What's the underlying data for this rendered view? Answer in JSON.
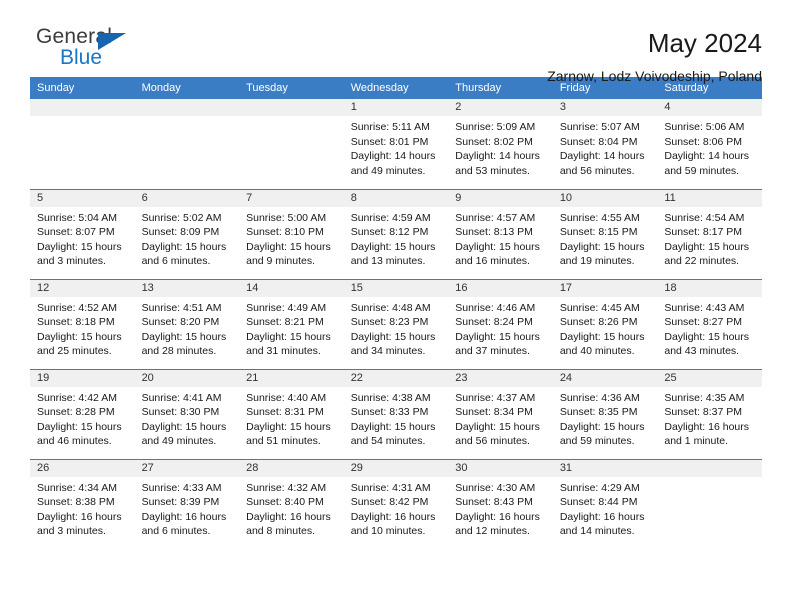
{
  "brand": {
    "word_one": "General",
    "word_two": "Blue",
    "triangle_color": "#1565b0",
    "blue_text_color": "#1a76c8"
  },
  "header": {
    "title": "May 2024",
    "subtitle": "Zarnow, Lodz Voivodeship, Poland"
  },
  "theme": {
    "header_bg": "#3a7dc4",
    "daynum_bg": "#f0f0f0",
    "row_divider": "#3a7dc4"
  },
  "weekdays": [
    "Sunday",
    "Monday",
    "Tuesday",
    "Wednesday",
    "Thursday",
    "Friday",
    "Saturday"
  ],
  "weeks": [
    [
      {
        "blank": true
      },
      {
        "blank": true
      },
      {
        "blank": true
      },
      {
        "day": "1",
        "sunrise": "Sunrise: 5:11 AM",
        "sunset": "Sunset: 8:01 PM",
        "daylight1": "Daylight: 14 hours",
        "daylight2": "and 49 minutes."
      },
      {
        "day": "2",
        "sunrise": "Sunrise: 5:09 AM",
        "sunset": "Sunset: 8:02 PM",
        "daylight1": "Daylight: 14 hours",
        "daylight2": "and 53 minutes."
      },
      {
        "day": "3",
        "sunrise": "Sunrise: 5:07 AM",
        "sunset": "Sunset: 8:04 PM",
        "daylight1": "Daylight: 14 hours",
        "daylight2": "and 56 minutes."
      },
      {
        "day": "4",
        "sunrise": "Sunrise: 5:06 AM",
        "sunset": "Sunset: 8:06 PM",
        "daylight1": "Daylight: 14 hours",
        "daylight2": "and 59 minutes."
      }
    ],
    [
      {
        "day": "5",
        "sunrise": "Sunrise: 5:04 AM",
        "sunset": "Sunset: 8:07 PM",
        "daylight1": "Daylight: 15 hours",
        "daylight2": "and 3 minutes."
      },
      {
        "day": "6",
        "sunrise": "Sunrise: 5:02 AM",
        "sunset": "Sunset: 8:09 PM",
        "daylight1": "Daylight: 15 hours",
        "daylight2": "and 6 minutes."
      },
      {
        "day": "7",
        "sunrise": "Sunrise: 5:00 AM",
        "sunset": "Sunset: 8:10 PM",
        "daylight1": "Daylight: 15 hours",
        "daylight2": "and 9 minutes."
      },
      {
        "day": "8",
        "sunrise": "Sunrise: 4:59 AM",
        "sunset": "Sunset: 8:12 PM",
        "daylight1": "Daylight: 15 hours",
        "daylight2": "and 13 minutes."
      },
      {
        "day": "9",
        "sunrise": "Sunrise: 4:57 AM",
        "sunset": "Sunset: 8:13 PM",
        "daylight1": "Daylight: 15 hours",
        "daylight2": "and 16 minutes."
      },
      {
        "day": "10",
        "sunrise": "Sunrise: 4:55 AM",
        "sunset": "Sunset: 8:15 PM",
        "daylight1": "Daylight: 15 hours",
        "daylight2": "and 19 minutes."
      },
      {
        "day": "11",
        "sunrise": "Sunrise: 4:54 AM",
        "sunset": "Sunset: 8:17 PM",
        "daylight1": "Daylight: 15 hours",
        "daylight2": "and 22 minutes."
      }
    ],
    [
      {
        "day": "12",
        "sunrise": "Sunrise: 4:52 AM",
        "sunset": "Sunset: 8:18 PM",
        "daylight1": "Daylight: 15 hours",
        "daylight2": "and 25 minutes."
      },
      {
        "day": "13",
        "sunrise": "Sunrise: 4:51 AM",
        "sunset": "Sunset: 8:20 PM",
        "daylight1": "Daylight: 15 hours",
        "daylight2": "and 28 minutes."
      },
      {
        "day": "14",
        "sunrise": "Sunrise: 4:49 AM",
        "sunset": "Sunset: 8:21 PM",
        "daylight1": "Daylight: 15 hours",
        "daylight2": "and 31 minutes."
      },
      {
        "day": "15",
        "sunrise": "Sunrise: 4:48 AM",
        "sunset": "Sunset: 8:23 PM",
        "daylight1": "Daylight: 15 hours",
        "daylight2": "and 34 minutes."
      },
      {
        "day": "16",
        "sunrise": "Sunrise: 4:46 AM",
        "sunset": "Sunset: 8:24 PM",
        "daylight1": "Daylight: 15 hours",
        "daylight2": "and 37 minutes."
      },
      {
        "day": "17",
        "sunrise": "Sunrise: 4:45 AM",
        "sunset": "Sunset: 8:26 PM",
        "daylight1": "Daylight: 15 hours",
        "daylight2": "and 40 minutes."
      },
      {
        "day": "18",
        "sunrise": "Sunrise: 4:43 AM",
        "sunset": "Sunset: 8:27 PM",
        "daylight1": "Daylight: 15 hours",
        "daylight2": "and 43 minutes."
      }
    ],
    [
      {
        "day": "19",
        "sunrise": "Sunrise: 4:42 AM",
        "sunset": "Sunset: 8:28 PM",
        "daylight1": "Daylight: 15 hours",
        "daylight2": "and 46 minutes."
      },
      {
        "day": "20",
        "sunrise": "Sunrise: 4:41 AM",
        "sunset": "Sunset: 8:30 PM",
        "daylight1": "Daylight: 15 hours",
        "daylight2": "and 49 minutes."
      },
      {
        "day": "21",
        "sunrise": "Sunrise: 4:40 AM",
        "sunset": "Sunset: 8:31 PM",
        "daylight1": "Daylight: 15 hours",
        "daylight2": "and 51 minutes."
      },
      {
        "day": "22",
        "sunrise": "Sunrise: 4:38 AM",
        "sunset": "Sunset: 8:33 PM",
        "daylight1": "Daylight: 15 hours",
        "daylight2": "and 54 minutes."
      },
      {
        "day": "23",
        "sunrise": "Sunrise: 4:37 AM",
        "sunset": "Sunset: 8:34 PM",
        "daylight1": "Daylight: 15 hours",
        "daylight2": "and 56 minutes."
      },
      {
        "day": "24",
        "sunrise": "Sunrise: 4:36 AM",
        "sunset": "Sunset: 8:35 PM",
        "daylight1": "Daylight: 15 hours",
        "daylight2": "and 59 minutes."
      },
      {
        "day": "25",
        "sunrise": "Sunrise: 4:35 AM",
        "sunset": "Sunset: 8:37 PM",
        "daylight1": "Daylight: 16 hours",
        "daylight2": "and 1 minute."
      }
    ],
    [
      {
        "day": "26",
        "sunrise": "Sunrise: 4:34 AM",
        "sunset": "Sunset: 8:38 PM",
        "daylight1": "Daylight: 16 hours",
        "daylight2": "and 3 minutes."
      },
      {
        "day": "27",
        "sunrise": "Sunrise: 4:33 AM",
        "sunset": "Sunset: 8:39 PM",
        "daylight1": "Daylight: 16 hours",
        "daylight2": "and 6 minutes."
      },
      {
        "day": "28",
        "sunrise": "Sunrise: 4:32 AM",
        "sunset": "Sunset: 8:40 PM",
        "daylight1": "Daylight: 16 hours",
        "daylight2": "and 8 minutes."
      },
      {
        "day": "29",
        "sunrise": "Sunrise: 4:31 AM",
        "sunset": "Sunset: 8:42 PM",
        "daylight1": "Daylight: 16 hours",
        "daylight2": "and 10 minutes."
      },
      {
        "day": "30",
        "sunrise": "Sunrise: 4:30 AM",
        "sunset": "Sunset: 8:43 PM",
        "daylight1": "Daylight: 16 hours",
        "daylight2": "and 12 minutes."
      },
      {
        "day": "31",
        "sunrise": "Sunrise: 4:29 AM",
        "sunset": "Sunset: 8:44 PM",
        "daylight1": "Daylight: 16 hours",
        "daylight2": "and 14 minutes."
      },
      {
        "blank": true
      }
    ]
  ]
}
